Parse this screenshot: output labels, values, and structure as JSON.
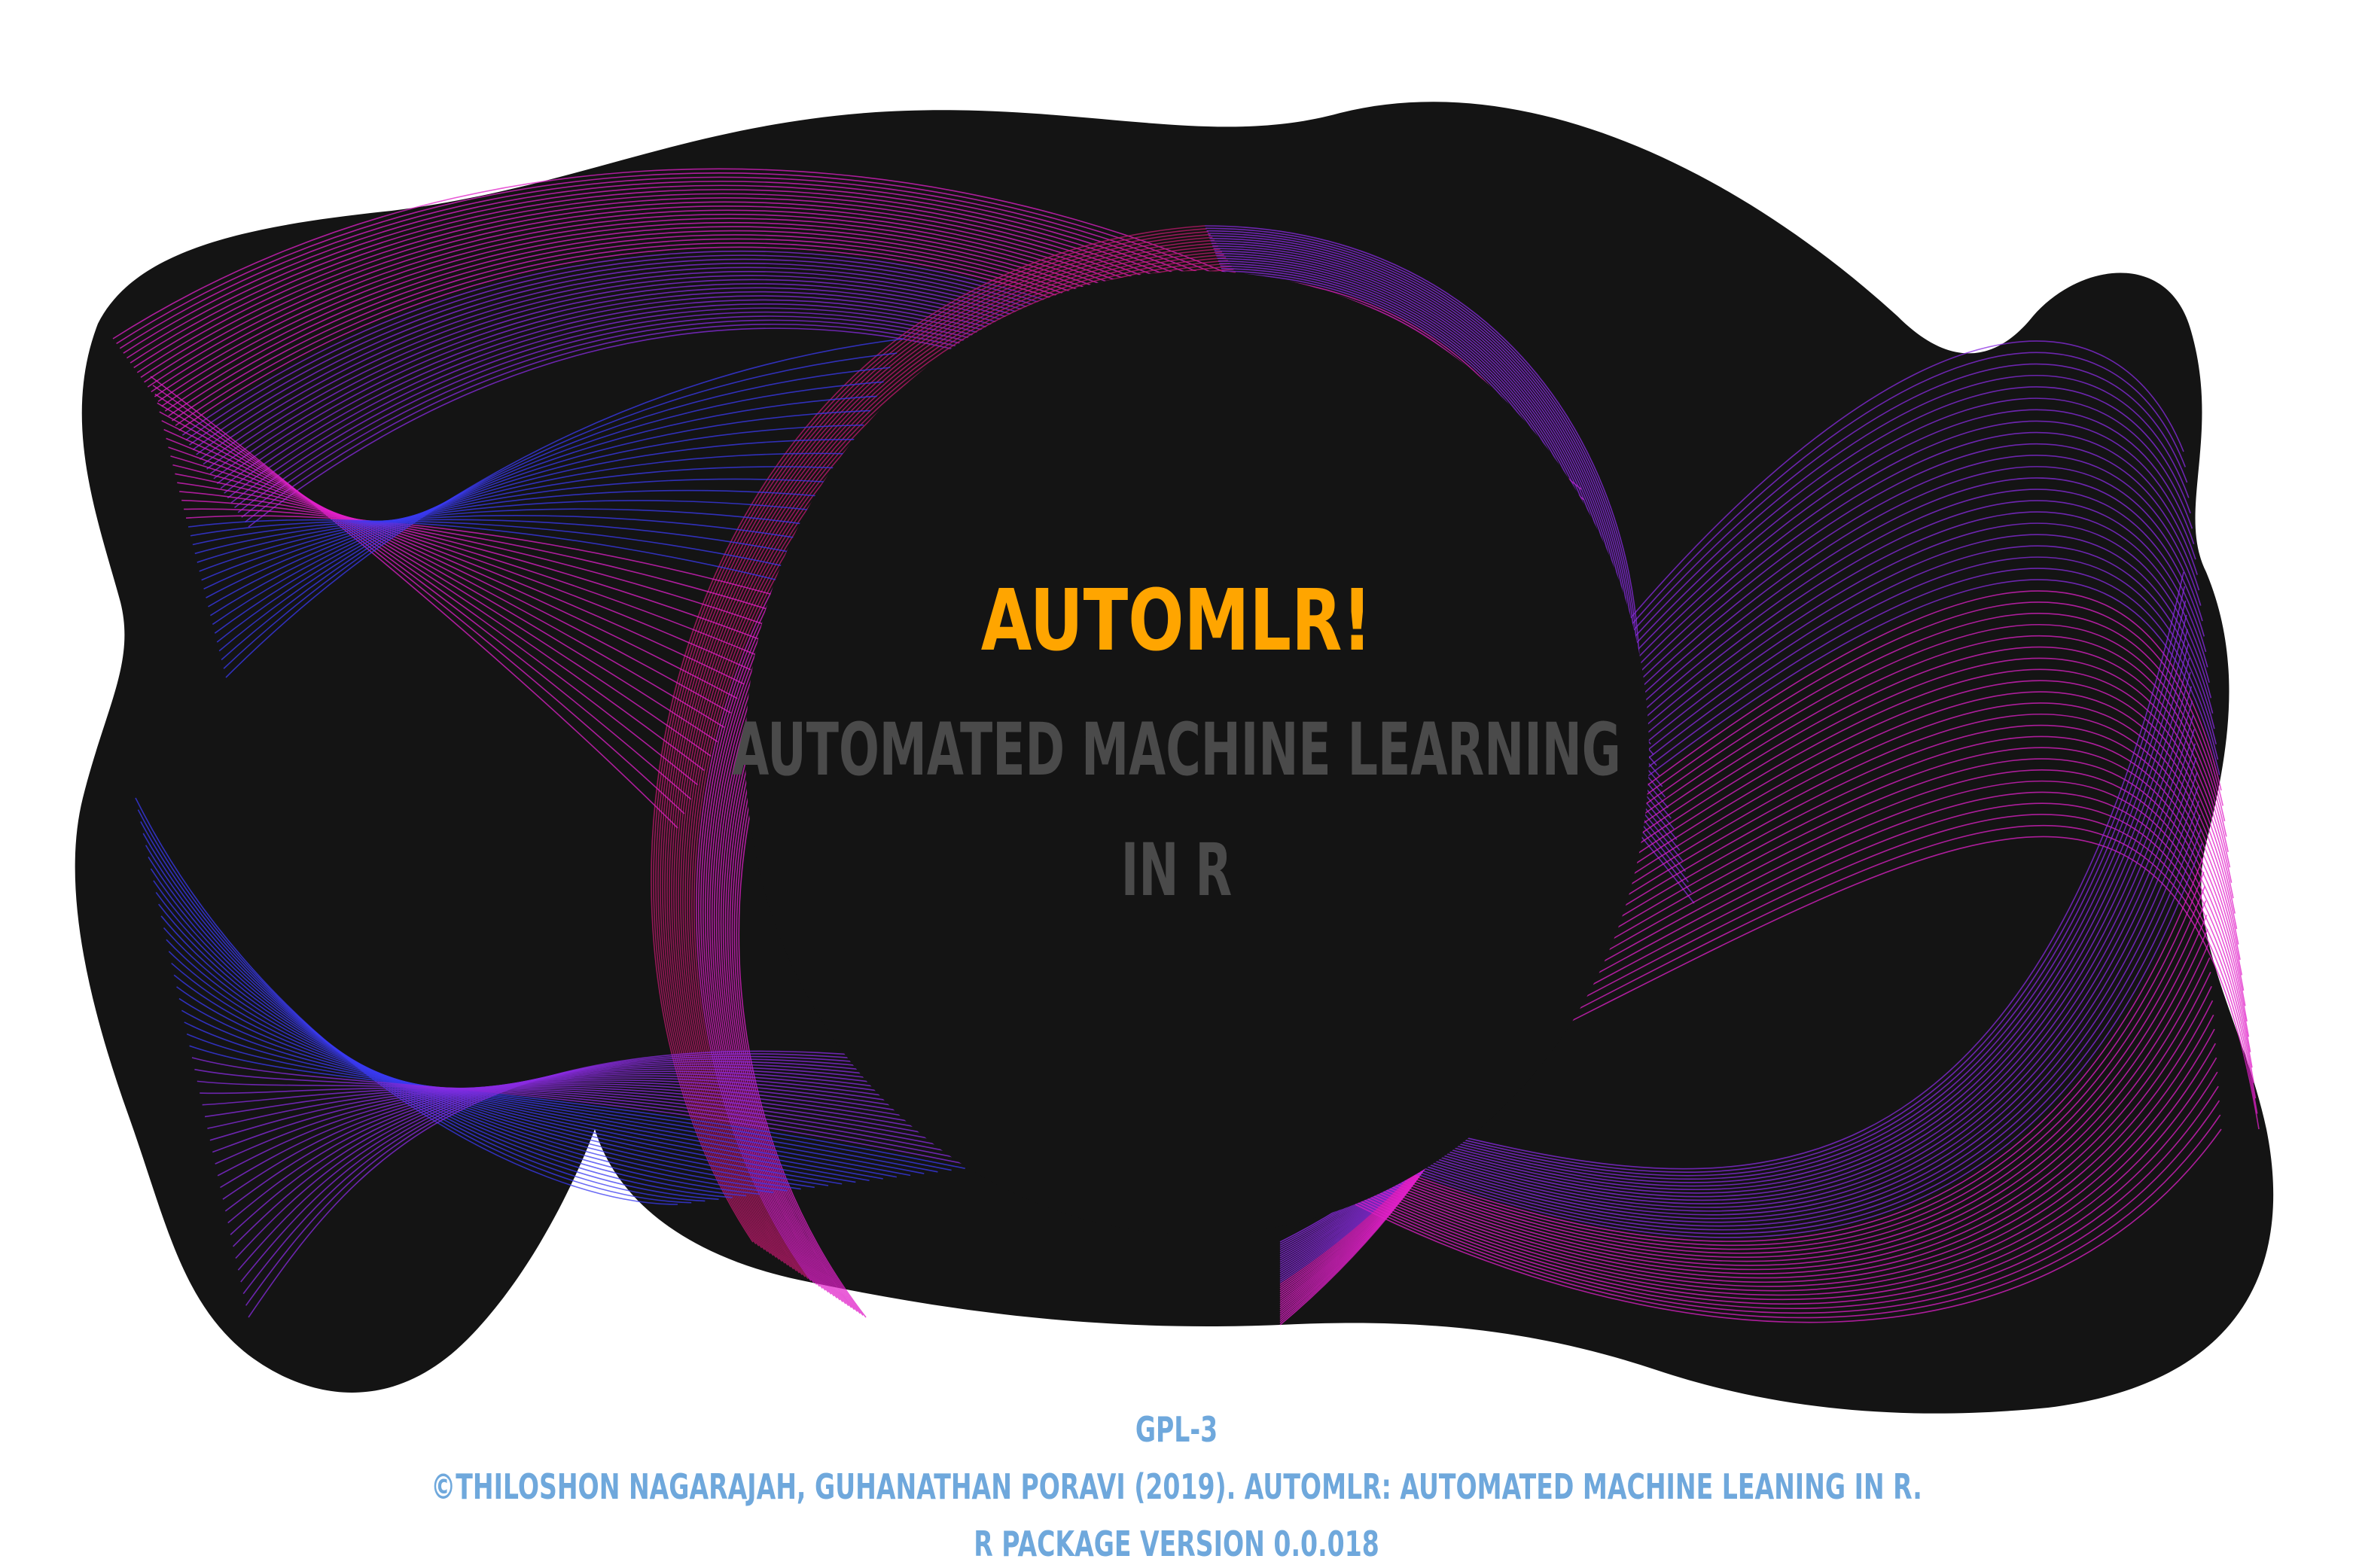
{
  "title": "AUTOMLR!",
  "subtitle": [
    "AUTOMATED MACHINE LEARNING",
    "IN R"
  ],
  "footer": [
    "GPL-3",
    "©THILOSHON NAGARAJAH, GUHANATHAN PORAVI (2019). AUTOMLR: AUTOMATED MACHINE LEANING IN R.",
    "R PACKAGE VERSION 0.0.018"
  ],
  "colors": {
    "background": "#ffffff",
    "blob": "#141414",
    "title": "#FFA500",
    "subtitle": "#4a4a4a",
    "footer": "#6FA8DC",
    "wave_magenta": "#E020C8",
    "wave_purple": "#8A2BE2",
    "wave_blue": "#3A3AF0",
    "wave_pink": "#C01A6E"
  }
}
